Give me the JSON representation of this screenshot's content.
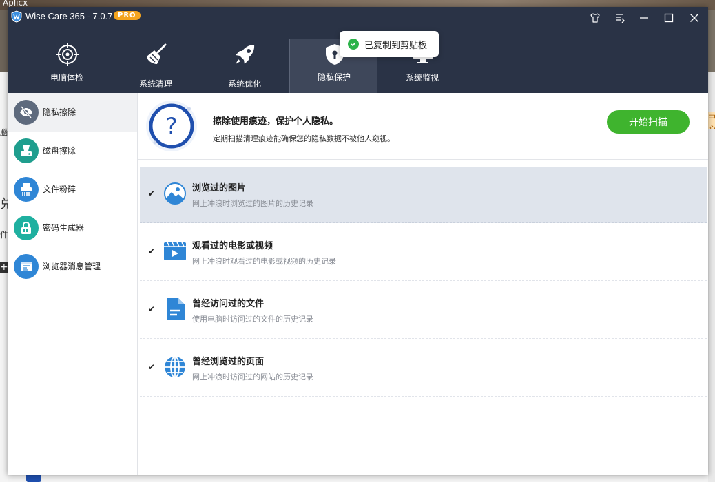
{
  "background": {
    "top_text": "Aplicx",
    "left_fragments": [
      "腦",
      "兑",
      "件",
      "+"
    ],
    "right_fragment": "中心"
  },
  "window": {
    "app_name": "Wise Care 365 - 7.0.7",
    "badge": "PRO"
  },
  "nav": {
    "items": [
      {
        "label": "电脑体检",
        "icon": "crosshair-icon"
      },
      {
        "label": "系统清理",
        "icon": "broom-icon"
      },
      {
        "label": "系统优化",
        "icon": "rocket-icon"
      },
      {
        "label": "隐私保护",
        "icon": "shield-lock-icon"
      },
      {
        "label": "系统监视",
        "icon": "monitor-icon"
      }
    ],
    "active_index": 3
  },
  "toast": {
    "text": "已复制到剪贴板"
  },
  "sidebar": {
    "items": [
      {
        "label": "隐私擦除",
        "icon": "eye-slash-icon",
        "color": "#5e6a7d"
      },
      {
        "label": "磁盘擦除",
        "icon": "disk-eraser-icon",
        "color": "#1f9e8e"
      },
      {
        "label": "文件粉碎",
        "icon": "shredder-icon",
        "color": "#2f86d6"
      },
      {
        "label": "密码生成器",
        "icon": "padlock-icon",
        "color": "#1fb0a0"
      },
      {
        "label": "浏览器消息管理",
        "icon": "browser-icon",
        "color": "#2f86d6"
      }
    ]
  },
  "banner": {
    "title": "擦除使用痕迹，保护个人隐私。",
    "description": "定期扫描清理痕迹能确保您的隐私数据不被他人窥视。",
    "scan_button": "开始扫描"
  },
  "items": [
    {
      "title": "浏览过的图片",
      "description": "网上冲浪时浏览过的图片的历史记录",
      "checked": true,
      "icon": "image-icon"
    },
    {
      "title": "观看过的电影或视频",
      "description": "网上冲浪时观看过的电影或视频的历史记录",
      "checked": true,
      "icon": "video-icon"
    },
    {
      "title": "曾经访问过的文件",
      "description": "使用电脑时访问过的文件的历史记录",
      "checked": true,
      "icon": "document-icon"
    },
    {
      "title": "曾经浏览过的页面",
      "description": "网上冲浪时访问过的网站的历史记录",
      "checked": true,
      "icon": "globe-icon"
    }
  ],
  "colors": {
    "header_bg": "#2a3346",
    "accent_green": "#3fb42e",
    "item_blue": "#2f86d6",
    "pro_orange": "#f4a41e"
  }
}
